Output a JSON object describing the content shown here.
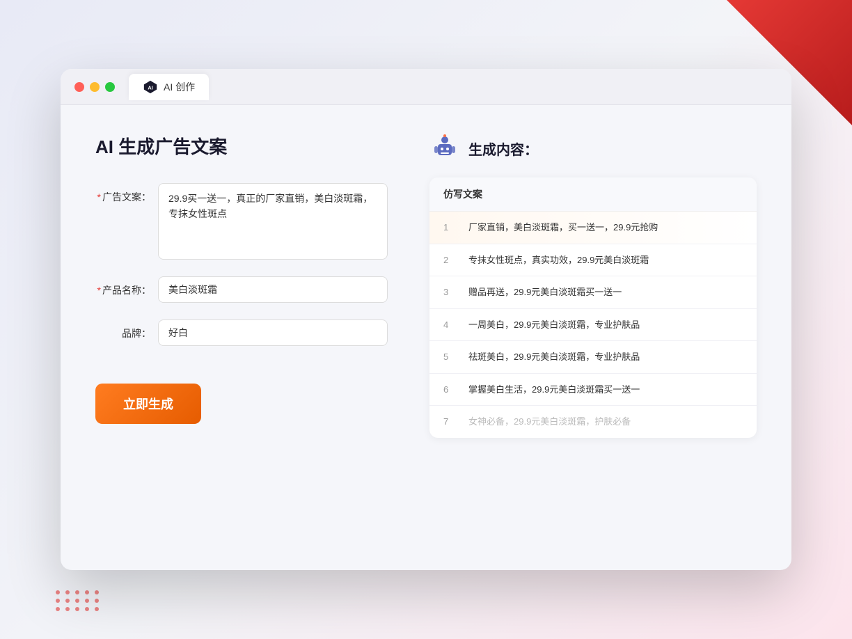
{
  "window": {
    "tab_title": "AI 创作"
  },
  "page": {
    "title": "AI 生成广告文案",
    "form": {
      "ad_copy_label": "广告文案：",
      "ad_copy_required": "*",
      "ad_copy_value": "29.9买一送一，真正的厂家直销，美白淡斑霜，专抹女性斑点",
      "product_name_label": "产品名称：",
      "product_name_required": "*",
      "product_name_value": "美白淡斑霜",
      "brand_label": "品牌：",
      "brand_value": "好白",
      "generate_button": "立即生成"
    },
    "result": {
      "header_title": "生成内容：",
      "table_header": "仿写文案",
      "items": [
        {
          "num": "1",
          "text": "厂家直销，美白淡斑霜，买一送一，29.9元抢购",
          "muted": false
        },
        {
          "num": "2",
          "text": "专抹女性斑点，真实功效，29.9元美白淡斑霜",
          "muted": false
        },
        {
          "num": "3",
          "text": "赠品再送，29.9元美白淡斑霜买一送一",
          "muted": false
        },
        {
          "num": "4",
          "text": "一周美白，29.9元美白淡斑霜，专业护肤品",
          "muted": false
        },
        {
          "num": "5",
          "text": "祛斑美白，29.9元美白淡斑霜，专业护肤品",
          "muted": false
        },
        {
          "num": "6",
          "text": "掌握美白生活，29.9元美白淡斑霜买一送一",
          "muted": false
        },
        {
          "num": "7",
          "text": "女神必备，29.9元美白淡斑霜，护肤必备",
          "muted": true
        }
      ]
    }
  },
  "colors": {
    "orange": "#f07020",
    "red_required": "#e53935",
    "text_primary": "#1a1a2e",
    "text_secondary": "#666",
    "text_muted": "#bbb"
  }
}
